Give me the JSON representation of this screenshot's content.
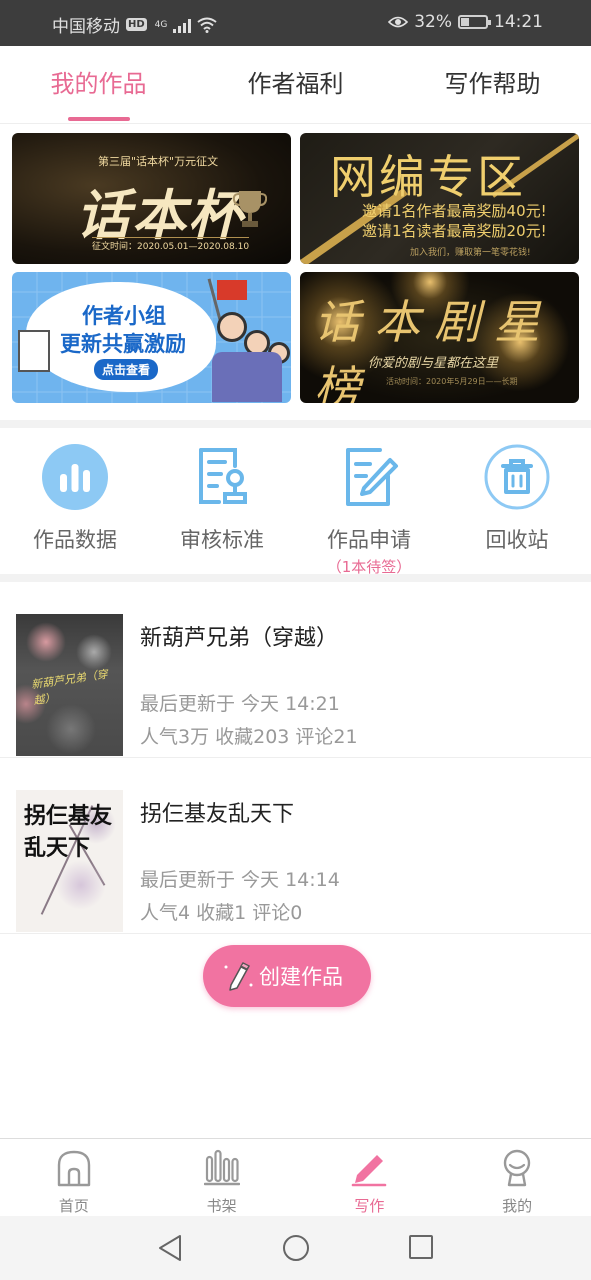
{
  "status_bar": {
    "carrier": "中国移动",
    "hd_badge": "HD",
    "network": "4G",
    "battery_percent": "32%",
    "battery_level": 0.32,
    "time": "14:21"
  },
  "tabs": [
    {
      "label": "我的作品",
      "active": true
    },
    {
      "label": "作者福利",
      "active": false
    },
    {
      "label": "写作帮助",
      "active": false
    }
  ],
  "banners": {
    "b1": {
      "sub": "第三届\"话本杯\"万元征文",
      "big": "话本杯",
      "date": "征文时间：2020.05.01—2020.08.10"
    },
    "b2": {
      "title": "网编专区",
      "line1": "邀请1名作者最高奖励40元!",
      "line2": "邀请1名读者最高奖励20元!",
      "small": "加入我们，赚取第一笔零花钱!"
    },
    "b3": {
      "t1": "作者小组",
      "t2": "更新共赢激励",
      "btn": "点击查看"
    },
    "b4": {
      "title": "话本剧星榜",
      "sub": "你爱的剧与星都在这里",
      "small": "活动时间：2020年5月29日——长期"
    }
  },
  "shortcuts": [
    {
      "label": "作品数据",
      "icon": "chart-icon"
    },
    {
      "label": "审核标准",
      "icon": "review-standard-icon"
    },
    {
      "label": "作品申请",
      "icon": "apply-edit-icon",
      "note": "（1本待签）"
    },
    {
      "label": "回收站",
      "icon": "trash-icon"
    }
  ],
  "books": [
    {
      "title": "新葫芦兄弟（穿越）",
      "updated": "最后更新于 今天 14:21",
      "stats": "人气3万  收藏203  评论21",
      "cover_text": "新葫芦兄弟（穿越）"
    },
    {
      "title": "拐仨基友乱天下",
      "updated": "最后更新于 今天 14:14",
      "stats": "人气4  收藏1  评论0",
      "cover_text": "拐仨基友乱天下"
    }
  ],
  "fab": {
    "label": "创建作品"
  },
  "bottom_nav": [
    {
      "label": "首页",
      "icon": "home-icon",
      "active": false
    },
    {
      "label": "书架",
      "icon": "bookshelf-icon",
      "active": false
    },
    {
      "label": "写作",
      "icon": "write-pen-icon",
      "active": true
    },
    {
      "label": "我的",
      "icon": "profile-icon",
      "active": false
    }
  ],
  "colors": {
    "accent": "#e86a93",
    "fab": "#f173a1",
    "icon_blue": "#5aaee8"
  }
}
